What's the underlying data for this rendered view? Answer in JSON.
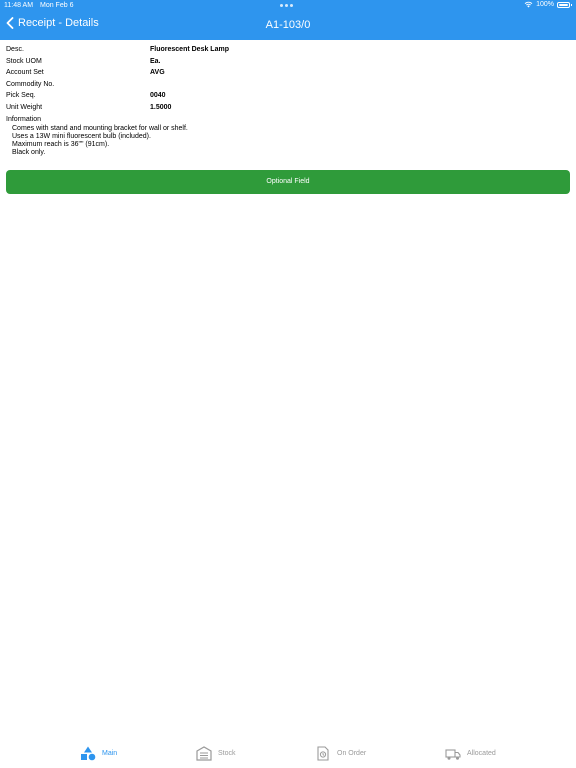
{
  "status_bar": {
    "time": "11:48 AM",
    "date": "Mon Feb 6",
    "battery": "100%",
    "battery_level": 1.0
  },
  "nav": {
    "back_label": "Receipt - Details",
    "title": "A1-103/0"
  },
  "details": [
    {
      "label": "Desc.",
      "value": "Fluorescent Desk Lamp"
    },
    {
      "label": "Stock UOM",
      "value": "Ea."
    },
    {
      "label": "Account Set",
      "value": "AVG"
    },
    {
      "label": "Commodity No.",
      "value": ""
    },
    {
      "label": "Pick Seq.",
      "value": "0040"
    },
    {
      "label": "Unit Weight",
      "value": "1.5000"
    }
  ],
  "information": {
    "label": "Information",
    "lines": [
      "Comes with stand and mounting bracket for wall or shelf.",
      "Uses a 13W mini fluorescent bulb (included).",
      "Maximum reach is 36\"\" (91cm).",
      "Black only."
    ]
  },
  "optional_field_button": "Optional Field",
  "colors": {
    "header": "#2e95ee",
    "button": "#2f9b3a",
    "tab_active": "#2e95ee",
    "tab_inactive": "#9a9a9a"
  },
  "tabs": [
    {
      "label": "Main",
      "icon": "shapes-icon",
      "active": true
    },
    {
      "label": "Stock",
      "icon": "warehouse-icon",
      "active": false
    },
    {
      "label": "On Order",
      "icon": "order-document-icon",
      "active": false
    },
    {
      "label": "Allocated",
      "icon": "delivery-truck-icon",
      "active": false
    }
  ]
}
